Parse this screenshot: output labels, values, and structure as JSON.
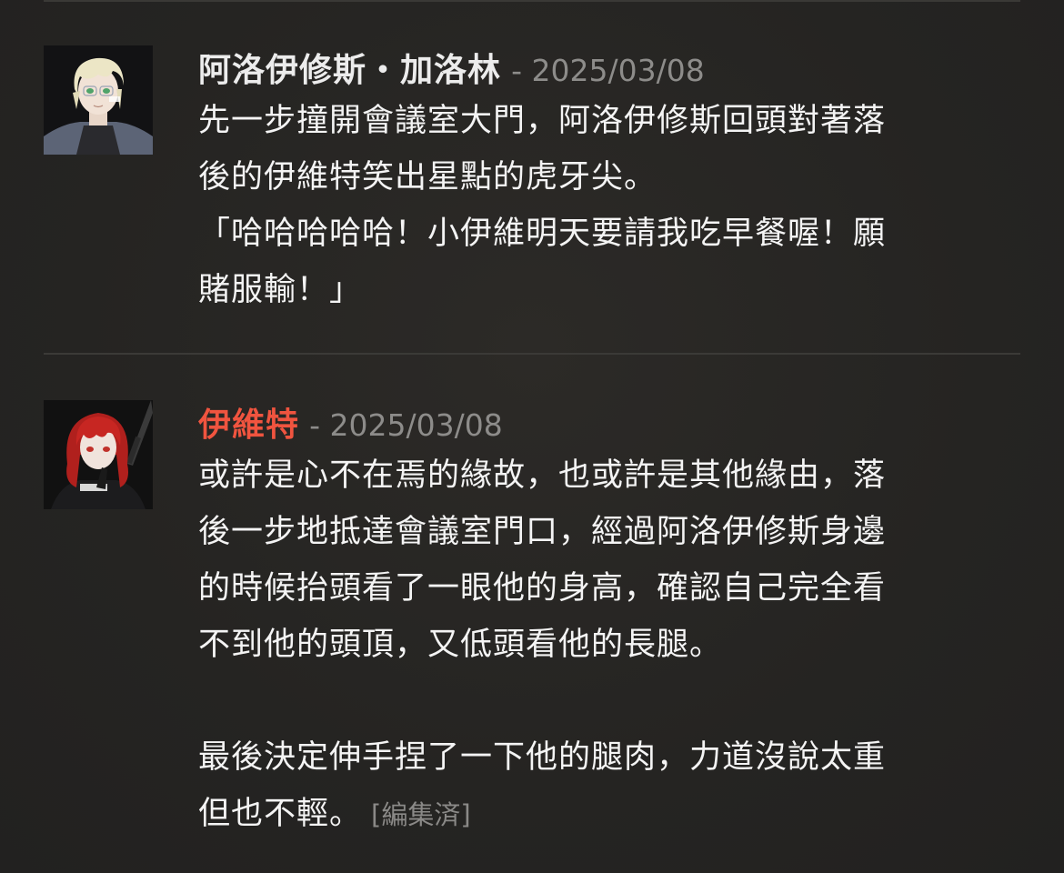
{
  "posts": [
    {
      "author": "阿洛伊修斯・加洛林",
      "date": "- 2025/03/08",
      "text": "先一步撞開會議室大門，阿洛伊修斯回頭對著落\n後的伊維特笑出星點的虎牙尖。\n「哈哈哈哈哈！小伊維明天要請我吃早餐喔！願\n賭服輸！」",
      "avatar": "blond-character-avatar"
    },
    {
      "author": "伊維特",
      "date": "- 2025/03/08",
      "text": "或許是心不在焉的緣故，也或許是其他緣由，落\n後一步地抵達會議室門口，經過阿洛伊修斯身邊\n的時候抬頭看了一眼他的身高，確認自己完全看\n不到他的頭頂，又低頭看他的長腿。\n\n最後決定伸手捏了一下他的腿肉，力道沒說太重\n但也不輕。",
      "edited_label": "[編集済]",
      "avatar": "redhair-character-avatar"
    }
  ],
  "colors": {
    "background": "#262523",
    "author_1": "#ececec",
    "author_2": "#f0543f",
    "meta": "#8d8c8a"
  }
}
